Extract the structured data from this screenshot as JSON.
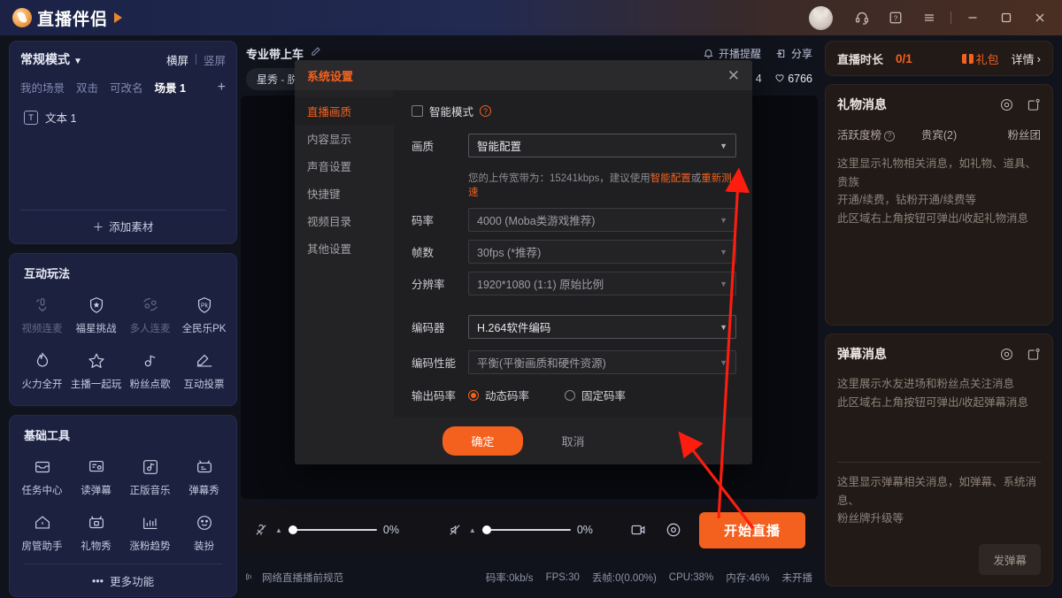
{
  "titlebar": {
    "app_name": "直播伴侣",
    "icons": [
      {
        "name": "headset-icon",
        "glyph": "🎧"
      },
      {
        "name": "help-icon",
        "glyph": "?"
      },
      {
        "name": "menu-icon",
        "glyph": "☰"
      },
      {
        "name": "minimize-icon",
        "glyph": "—"
      },
      {
        "name": "maximize-icon",
        "glyph": "▢"
      },
      {
        "name": "close-icon",
        "glyph": "✕"
      }
    ]
  },
  "scene_panel": {
    "mode_label": "常规模式",
    "landscape_label": "横屏",
    "portrait_label": "竖屏",
    "tabs": [
      {
        "label": "我的场景",
        "active": false
      },
      {
        "label": "双击",
        "active": false
      },
      {
        "label": "可改名",
        "active": false
      },
      {
        "label": "场景 1",
        "active": true
      }
    ],
    "add_scene": "+",
    "sources": [
      {
        "icon": "text-icon",
        "glyph": "T",
        "label": "文本 1"
      }
    ],
    "add_material_label": "添加素材"
  },
  "interactive_tools": {
    "title": "互动玩法",
    "items": [
      {
        "label": "视频连麦",
        "icon": "video-mic-icon",
        "dim": true
      },
      {
        "label": "福星挑战",
        "icon": "shield-star-icon",
        "dim": false
      },
      {
        "label": "多人连麦",
        "icon": "multi-mic-icon",
        "dim": true
      },
      {
        "label": "全民乐PK",
        "icon": "pk-shield-icon",
        "dim": false
      },
      {
        "label": "火力全开",
        "icon": "flame-icon",
        "dim": false
      },
      {
        "label": "主播一起玩",
        "icon": "star-icon",
        "dim": false
      },
      {
        "label": "粉丝点歌",
        "icon": "music-note-icon",
        "dim": false
      },
      {
        "label": "互动投票",
        "icon": "ballot-box-icon",
        "dim": false
      }
    ]
  },
  "basic_tools": {
    "title": "基础工具",
    "items": [
      {
        "label": "任务中心",
        "icon": "inbox-icon"
      },
      {
        "label": "读弹幕",
        "icon": "read-danmaku-icon"
      },
      {
        "label": "正版音乐",
        "icon": "music-app-icon"
      },
      {
        "label": "弹幕秀",
        "icon": "tv-icon"
      },
      {
        "label": "房管助手",
        "icon": "home-icon"
      },
      {
        "label": "礼物秀",
        "icon": "gift-tv-icon"
      },
      {
        "label": "涨粉趋势",
        "icon": "chart-icon"
      },
      {
        "label": "装扮",
        "icon": "smiley-icon"
      }
    ],
    "more_label": "更多功能"
  },
  "center": {
    "room_title": "专业带上车",
    "edit_icon": "edit-icon",
    "notify_label": "开播提醒",
    "share_label": "分享",
    "category_chip": "星秀 - 脱",
    "stats": [
      {
        "icon": "comment-icon",
        "value": "4"
      },
      {
        "icon": "heart-icon",
        "value": "6766"
      }
    ],
    "controls": {
      "mic_volume": "0%",
      "speaker_volume": "0%",
      "screen_record_icon": "record-screen-icon",
      "settings_icon": "settings-gear-icon",
      "start_button": "开始直播"
    },
    "status": {
      "guide_label": "网络直播播前规范",
      "bitrate": "码率:0kb/s",
      "fps": "FPS:30",
      "drop": "丢帧:0(0.00%)",
      "cpu": "CPU:38%",
      "memory": "内存:46%",
      "live_state": "未开播"
    }
  },
  "right": {
    "duration": {
      "label": "直播时长",
      "value": "0/1",
      "gift_pack": "礼包",
      "detail": "详情"
    },
    "gift_panel": {
      "title": "礼物消息",
      "tabs": [
        "活跃度榜",
        "贵宾(2)",
        "粉丝团"
      ],
      "body_lines": [
        "这里显示礼物相关消息，如礼物、道具、贵族",
        "开通/续费，钻粉开通/续费等",
        "此区域右上角按钮可弹出/收起礼物消息"
      ]
    },
    "danmaku_panel": {
      "title": "弹幕消息",
      "top_lines": [
        "这里展示水友进场和粉丝点关注消息",
        "此区域右上角按钮可弹出/收起弹幕消息"
      ],
      "bottom_lines": [
        "这里显示弹幕相关消息，如弹幕、系统消息、",
        "粉丝牌升级等"
      ],
      "send_button": "发弹幕"
    }
  },
  "modal": {
    "title": "系统设置",
    "close_icon": "close-icon",
    "nav": [
      {
        "label": "直播画质",
        "active": true
      },
      {
        "label": "内容显示",
        "active": false
      },
      {
        "label": "声音设置",
        "active": false
      },
      {
        "label": "快捷键",
        "active": false
      },
      {
        "label": "视频目录",
        "active": false
      },
      {
        "label": "其他设置",
        "active": false
      }
    ],
    "smart_mode_label": "智能模式",
    "fields": [
      {
        "label": "画质",
        "value": "智能配置",
        "muted": false
      },
      {
        "label": "码率",
        "value": "4000 (Moba类游戏推荐)",
        "muted": true
      },
      {
        "label": "帧数",
        "value": "30fps (*推荐)",
        "muted": true
      },
      {
        "label": "分辨率",
        "value": "1920*1080 (1:1) 原始比例",
        "muted": true
      },
      {
        "label": "编码器",
        "value": "H.264软件编码",
        "muted": false
      },
      {
        "label": "编码性能",
        "value": "平衡(平衡画质和硬件资源)",
        "muted": true
      }
    ],
    "hint": {
      "prefix": "您的上传宽带为：15241kbps，建议使用",
      "link1": "智能配置",
      "middle": "或",
      "link2": "重新测速"
    },
    "output_bitrate": {
      "label": "输出码率",
      "options": [
        {
          "label": "动态码率",
          "selected": true
        },
        {
          "label": "固定码率",
          "selected": false
        }
      ]
    },
    "ok_label": "确定",
    "cancel_label": "取消"
  },
  "colors": {
    "accent": "#f4611f",
    "panel_blue": "#1c2140",
    "panel_brown": "#221a17",
    "modal_bg": "#1f1f21"
  }
}
